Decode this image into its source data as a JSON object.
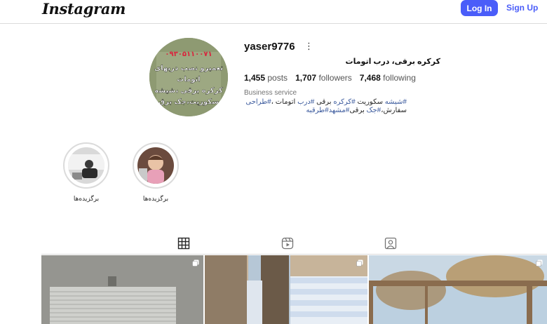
{
  "header": {
    "logo": "Instagram",
    "login_label": "Log In",
    "signup_label": "Sign Up"
  },
  "profile": {
    "username": "yaser9776",
    "full_name": "کرکره برقی، درب اتومات",
    "stats": {
      "posts_count": "1,455",
      "posts_label": "posts",
      "followers_count": "1,707",
      "followers_label": "followers",
      "following_count": "7,468",
      "following_label": "following"
    },
    "category": "Business service",
    "bio": {
      "line1_tag1": "#شیشه",
      "line1_text": " سکوریت ",
      "line1_tag2": "#کرکره",
      "line1_text2": " برقی ",
      "line1_tag3": "#درب",
      "line1_text3": " اتومات ،",
      "line1_tag4": "#طراحی",
      "line2_text": "سفارش،",
      "line2_tag1": "#جک",
      "line2_text2": " برقی",
      "line2_tag2": "#مشهد",
      "line2_tag3": "#طرقبه"
    },
    "avatar_text": {
      "phone": "۰۹۳۰۵۱۱۰۰۷۱",
      "line1": "تعمیرو نصب دربهای",
      "line2": "اتومات",
      "line3": "کرکره برقی ،شیشه",
      "line4": "سکوریت،جک برق"
    }
  },
  "highlights": [
    {
      "label": "برگزیده‌ها"
    },
    {
      "label": "برگزیده‌ها"
    }
  ],
  "tabs": [
    "posts-grid",
    "reels",
    "tagged"
  ],
  "colors": {
    "accent": "#4a5df9",
    "hashtag": "#3b5a9d",
    "border": "#dbdbdb"
  },
  "posts": [
    {
      "type": "carousel"
    },
    {
      "type": "carousel"
    },
    {
      "type": "carousel"
    }
  ]
}
